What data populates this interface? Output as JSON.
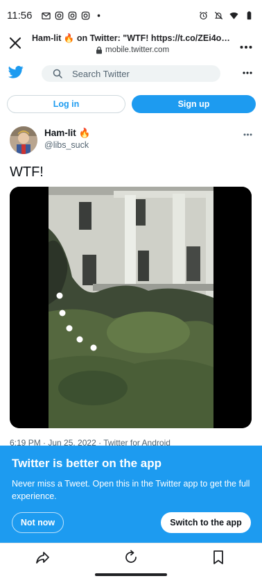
{
  "status_bar": {
    "time": "11:56"
  },
  "custom_tab": {
    "title": "Ham-lit 🔥 on Twitter: \"WTF! https://t.co/ZEi4oA5RqX...",
    "url": "mobile.twitter.com"
  },
  "header": {
    "search_placeholder": "Search Twitter"
  },
  "auth": {
    "login_label": "Log in",
    "signup_label": "Sign up"
  },
  "tweet": {
    "display_name": "Ham-lit 🔥",
    "handle": "@libs_suck",
    "text": "WTF!",
    "meta": "6:19 PM · Jun 25, 2022 · Twitter for Android"
  },
  "banner": {
    "title": "Twitter is better on the app",
    "body": "Never miss a Tweet. Open this in the Twitter app to get the full experience.",
    "not_now_label": "Not now",
    "switch_label": "Switch to the app"
  },
  "colors": {
    "twitter_blue": "#1d9bf0",
    "text_primary": "#0f1419",
    "text_secondary": "#536471"
  }
}
